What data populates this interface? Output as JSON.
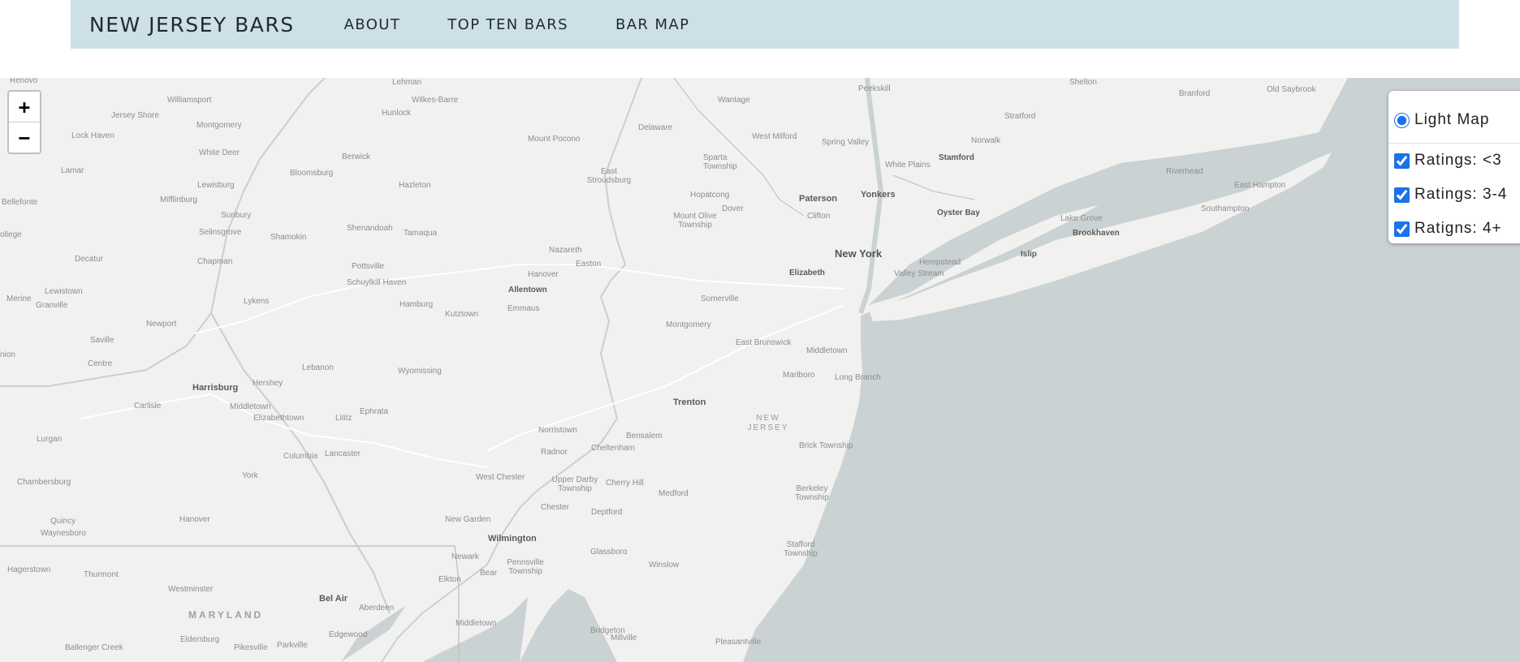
{
  "nav": {
    "brand": "NEW JERSEY BARS",
    "links": [
      "ABOUT",
      "TOP TEN BARS",
      "BAR MAP"
    ]
  },
  "map": {
    "zoom_in": "+",
    "zoom_out": "−",
    "colors": {
      "land": "#f1f1f0",
      "water": "#cad2d3",
      "roads": "#ffffff",
      "borders": "#bdbdbd"
    },
    "layer_control": {
      "base_layer": "Light Map",
      "overlays": [
        "Ratings: <3",
        "Ratings: 3-4",
        "Ratigns: 4+"
      ]
    },
    "labels": {
      "renovo": "Renovo",
      "lehman": "Lehman",
      "shelton": "Shelton",
      "branford": "Branford",
      "old_saybrook": "Old Saybrook",
      "williamsport": "Williamsport",
      "wilkes_barre": "Wilkes-Barre",
      "wantage": "Wantage",
      "peekskill": "Peekskill",
      "stratford": "Stratford",
      "jersey_shore": "Jersey Shore",
      "hunlock": "Hunlock",
      "montgomery_pa": "Montgomery",
      "lock_haven": "Lock Haven",
      "mount_pocono": "Mount Pocono",
      "delaware": "Delaware",
      "west_milford": "West Milford",
      "spring_valley": "Spring Valley",
      "norwalk": "Norwalk",
      "white_deer": "White Deer",
      "berwick": "Berwick",
      "sparta": "Sparta Township",
      "white_plains": "White Plains",
      "stamford": "Stamford",
      "lamar": "Lamar",
      "bloomsburg": "Bloomsburg",
      "east_stroudsburg": "East Stroudsburg",
      "lewisburg": "Lewisburg",
      "hazleton": "Hazleton",
      "bellefonte": "Bellefonte",
      "mifflinburg": "Mifflinburg",
      "hopatcong": "Hopatcong",
      "paterson": "Paterson",
      "yonkers": "Yonkers",
      "sunbury": "Sunbury",
      "dover": "Dover",
      "clifton": "Clifton",
      "oyster_bay": "Oyster Bay",
      "east_hampton": "East Hampton",
      "riverhead": "Riverhead",
      "mount_olive": "Mount Olive Township",
      "shenandoah": "Shenandoah",
      "selinsgrove": "Selinsgrove",
      "tamaqua": "Tamaqua",
      "shamokin": "Shamokin",
      "lake_grove": "Lake Grove",
      "southampton": "Southampton",
      "college": "ollege",
      "brookhaven": "Brookhaven",
      "chapman": "Chapman",
      "nazareth": "Nazareth",
      "new_york": "New York",
      "decatur": "Decatur",
      "hempstead": "Hempstead",
      "islip": "Islip",
      "hanover_pa": "Hanover",
      "easton": "Easton",
      "pottsville": "Pottsville",
      "elizabeth": "Elizabeth",
      "valley_stream": "Valley Stream",
      "schuylkill_haven": "Schuylkill Haven",
      "lewistown": "Lewistown",
      "allentown": "Allentown",
      "merine": "Merine",
      "granville": "Granville",
      "lykens": "Lykens",
      "hamburg": "Hamburg",
      "somerville": "Somerville",
      "emmaus": "Emmaus",
      "kutztown": "Kutztown",
      "newport": "Newport",
      "montgomery_nj": "Montgomery",
      "saville": "Saville",
      "east_brunswick": "East Brunswick",
      "middletown_nj": "Middletown",
      "union": "nion",
      "centre": "Centre",
      "lebanon": "Lebanon",
      "wyomissing": "Wyomissing",
      "marlboro": "Marlboro",
      "long_branch": "Long Branch",
      "harrisburg": "Harrisburg",
      "hershey": "Hershey",
      "trenton": "Trenton",
      "carlisle": "Carlisle",
      "middletown_pa": "Middletown",
      "ephrata": "Ephrata",
      "elizabethtown": "Elizabethtown",
      "lititz": "Lititz",
      "nj_label": "NEW JERSEY",
      "norristown": "Norristown",
      "lurgan": "Lurgan",
      "bensalem": "Bensalem",
      "cheltenham": "Cheltenham",
      "brick": "Brick Township",
      "columbia": "Columbia",
      "lancaster": "Lancaster",
      "radnor": "Radnor",
      "chambersburg": "Chambersburg",
      "york": "York",
      "west_chester": "West Chester",
      "upper_darby": "Upper Darby Township",
      "cherry_hill": "Cherry Hill",
      "medford": "Medford",
      "berkeley": "Berkeley Township",
      "chester": "Chester",
      "deptford": "Deptford",
      "quincy": "Quincy",
      "hanover_md": "Hanover",
      "new_garden": "New Garden",
      "waynesboro": "Waynesboro",
      "wilmington": "Wilmington",
      "stafford": "Stafford Township",
      "glassboro": "Glassboro",
      "newark_de": "Newark",
      "hagerstown": "Hagerstown",
      "thurmont": "Thurmont",
      "pennsville": "Pennsville Township",
      "winslow": "Winslow",
      "bear": "Bear",
      "elkton": "Elkton",
      "westminster": "Westminster",
      "bel_air": "Bel Air",
      "aberdeen": "Aberdeen",
      "maryland": "MARYLAND",
      "middletown_de": "Middletown",
      "bridgeton": "Bridgeton",
      "edgewood": "Edgewood",
      "millville": "Millville",
      "eldersburg": "Eldersburg",
      "pleasantville": "Pleasantville",
      "ballenger_creek": "Ballenger Creek",
      "pikesville": "Pikesville",
      "parkville": "Parkville"
    }
  }
}
